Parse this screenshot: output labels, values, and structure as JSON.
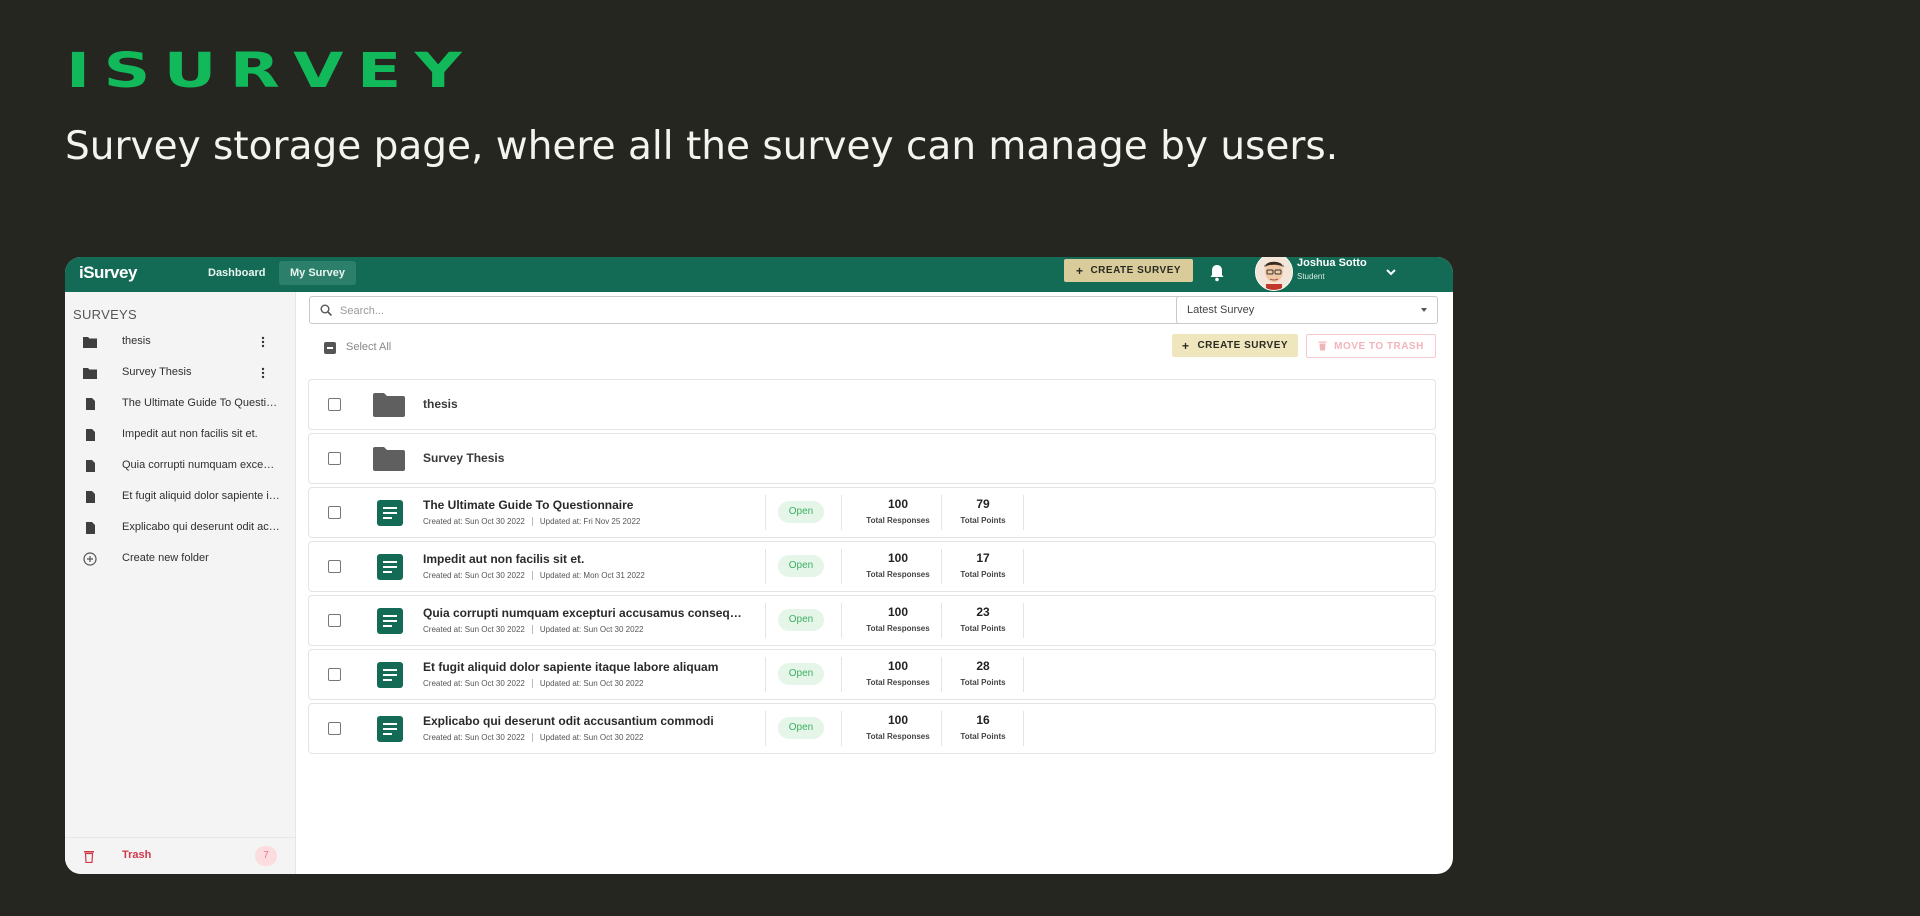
{
  "header": {
    "brand": "ISURVEY",
    "subtitle": "Survey storage page, where all the survey can manage by users."
  },
  "app": {
    "topbar": {
      "logo": "iSurvey",
      "nav": [
        "Dashboard",
        "My Survey"
      ],
      "active_nav": "My Survey",
      "create_label": "CREATE SURVEY",
      "user": {
        "name": "Joshua Sotto",
        "role": "Student"
      }
    },
    "sidebar": {
      "heading": "SURVEYS",
      "items": [
        {
          "label": "thesis",
          "icon": "folder-icon"
        },
        {
          "label": "Survey Thesis",
          "icon": "folder-icon"
        },
        {
          "label": "The Ultimate Guide To Questionnaire",
          "icon": "document-icon"
        },
        {
          "label": "Impedit aut non facilis sit et.",
          "icon": "document-icon"
        },
        {
          "label": "Quia corrupti numquam excepturi accusamus consequatur",
          "icon": "document-icon"
        },
        {
          "label": "Et fugit aliquid dolor sapiente itaque labore aliquam",
          "icon": "document-icon"
        },
        {
          "label": "Explicabo qui deserunt odit accusantium commodi",
          "icon": "document-icon"
        },
        {
          "label": "Create new folder",
          "icon": "add-circle-icon"
        }
      ],
      "trash": {
        "label": "Trash",
        "count": "7"
      }
    },
    "toolbar": {
      "search_placeholder": "Search...",
      "sort_value": "Latest Survey",
      "select_all": "Select All",
      "create_label": "CREATE SURVEY",
      "move_to_trash": "MOVE TO TRASH"
    },
    "folders": [
      {
        "name": "thesis"
      },
      {
        "name": "Survey Thesis"
      }
    ],
    "surveys": [
      {
        "title": "The Ultimate Guide To Questionnaire",
        "created": "Created at: Sun Oct 30 2022",
        "updated": "Updated at: Fri Nov 25 2022",
        "status": "Open",
        "responses": "100",
        "responses_label": "Total Responses",
        "points": "79",
        "points_label": "Total Points"
      },
      {
        "title": "Impedit aut non facilis sit et.",
        "created": "Created at: Sun Oct 30 2022",
        "updated": "Updated at: Mon Oct 31 2022",
        "status": "Open",
        "responses": "100",
        "responses_label": "Total Responses",
        "points": "17",
        "points_label": "Total Points"
      },
      {
        "title": "Quia corrupti numquam excepturi accusamus consequatur",
        "created": "Created at: Sun Oct 30 2022",
        "updated": "Updated at: Sun Oct 30 2022",
        "status": "Open",
        "responses": "100",
        "responses_label": "Total Responses",
        "points": "23",
        "points_label": "Total Points"
      },
      {
        "title": "Et fugit aliquid dolor sapiente itaque labore aliquam",
        "created": "Created at: Sun Oct 30 2022",
        "updated": "Updated at: Sun Oct 30 2022",
        "status": "Open",
        "responses": "100",
        "responses_label": "Total Responses",
        "points": "28",
        "points_label": "Total Points"
      },
      {
        "title": "Explicabo qui deserunt odit accusantium commodi",
        "created": "Created at: Sun Oct 30 2022",
        "updated": "Updated at: Sun Oct 30 2022",
        "status": "Open",
        "responses": "100",
        "responses_label": "Total Responses",
        "points": "16",
        "points_label": "Total Points"
      }
    ],
    "colors": {
      "brand_green": "#12b95a",
      "topbar": "#136a55",
      "accent_khaki": "#d9cc9a",
      "danger": "#d0384a",
      "status_green": "#3cb063"
    }
  }
}
